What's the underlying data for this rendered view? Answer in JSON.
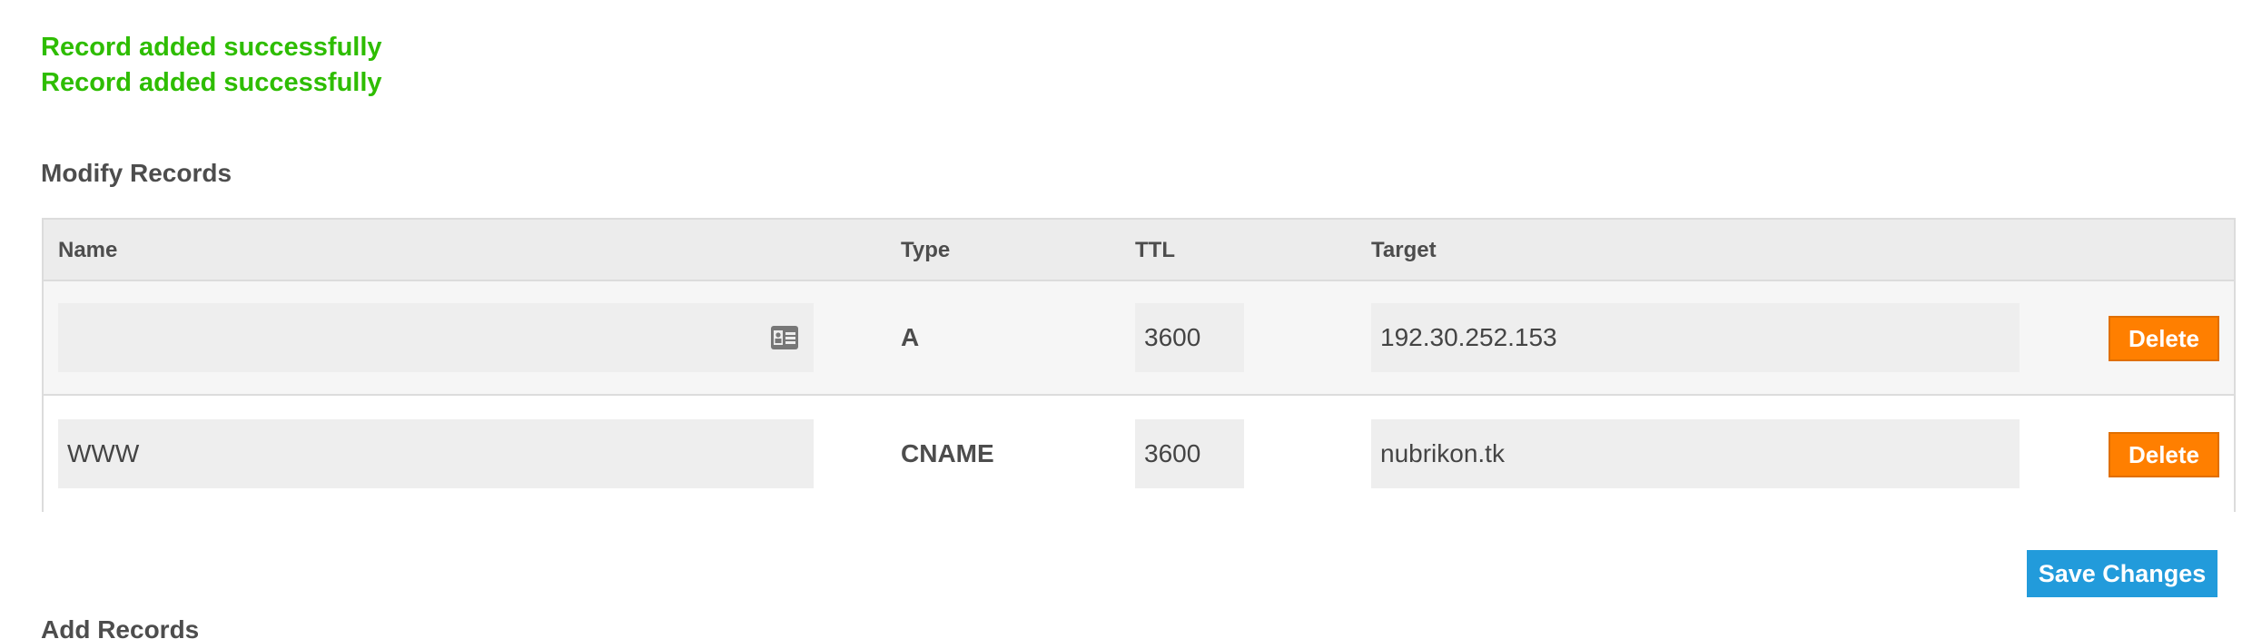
{
  "messages": [
    "Record added successfully",
    "Record added successfully"
  ],
  "modify_section": {
    "title": "Modify Records",
    "columns": {
      "name": "Name",
      "type": "Type",
      "ttl": "TTL",
      "target": "Target"
    },
    "records": [
      {
        "name": "",
        "name_icon": "contact-card-icon",
        "type": "A",
        "ttl": "3600",
        "target": "192.30.252.153",
        "delete_label": "Delete"
      },
      {
        "name": "WWW",
        "type": "CNAME",
        "ttl": "3600",
        "target": "nubrikon.tk",
        "delete_label": "Delete"
      }
    ],
    "save_label": "Save Changes"
  },
  "add_section": {
    "title": "Add Records"
  },
  "colors": {
    "success": "#2ebd00",
    "delete": "#ff7f00",
    "save": "#229bdb"
  }
}
